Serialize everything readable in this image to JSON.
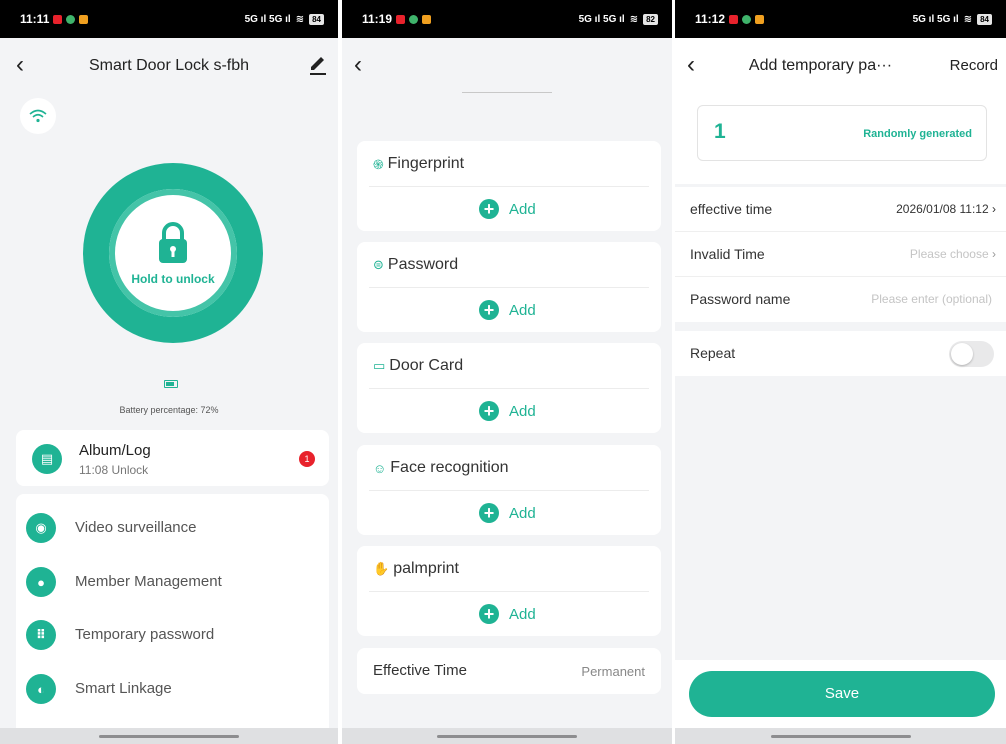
{
  "colors": {
    "accent": "#1fb394",
    "badge_red": "#e8222c",
    "background": "#f3f4f6"
  },
  "screen1": {
    "status": {
      "time": "11:11",
      "signal": "5G ıl 5G ıl",
      "battery": "84"
    },
    "title": "Smart Door Lock s-fbh",
    "lock_label": "Hold to unlock",
    "battery_text": "Battery percentage: 72%",
    "album": {
      "title": "Album/Log",
      "subtitle": "11:08 Unlock",
      "badge": "1"
    },
    "menu": [
      {
        "label": "Video surveillance",
        "icon": "camera-icon"
      },
      {
        "label": "Member Management",
        "icon": "person-icon"
      },
      {
        "label": "Temporary password",
        "icon": "keypad-icon"
      },
      {
        "label": "Smart Linkage",
        "icon": "toggle-icon"
      }
    ]
  },
  "screen2": {
    "status": {
      "time": "11:19",
      "signal": "5G ıl 5G ıl",
      "battery": "82"
    },
    "methods": [
      {
        "label": "Fingerprint",
        "icon": "fingerprint-icon",
        "add": "Add"
      },
      {
        "label": "Password",
        "icon": "password-icon",
        "add": "Add"
      },
      {
        "label": "Door Card",
        "icon": "card-icon",
        "add": "Add"
      },
      {
        "label": "Face recognition",
        "icon": "face-icon",
        "add": "Add"
      },
      {
        "label": "palmprint",
        "icon": "palm-icon",
        "add": "Add"
      }
    ],
    "effective": {
      "label": "Effective Time",
      "value": "Permanent"
    }
  },
  "screen3": {
    "status": {
      "time": "11:12",
      "signal": "5G ıl 5G ıl",
      "battery": "84"
    },
    "title": "Add temporary pa···",
    "record": "Record",
    "password_value": "1",
    "random_label": "Randomly generated",
    "rows": [
      {
        "label": "effective time",
        "value": "2026/01/08 11:12",
        "placeholder": false,
        "chevron": true
      },
      {
        "label": "Invalid Time",
        "value": "Please choose",
        "placeholder": true,
        "chevron": true
      },
      {
        "label": "Password name",
        "value": "Please enter (optional)",
        "placeholder": true,
        "chevron": false
      }
    ],
    "repeat_label": "Repeat",
    "save": "Save"
  }
}
